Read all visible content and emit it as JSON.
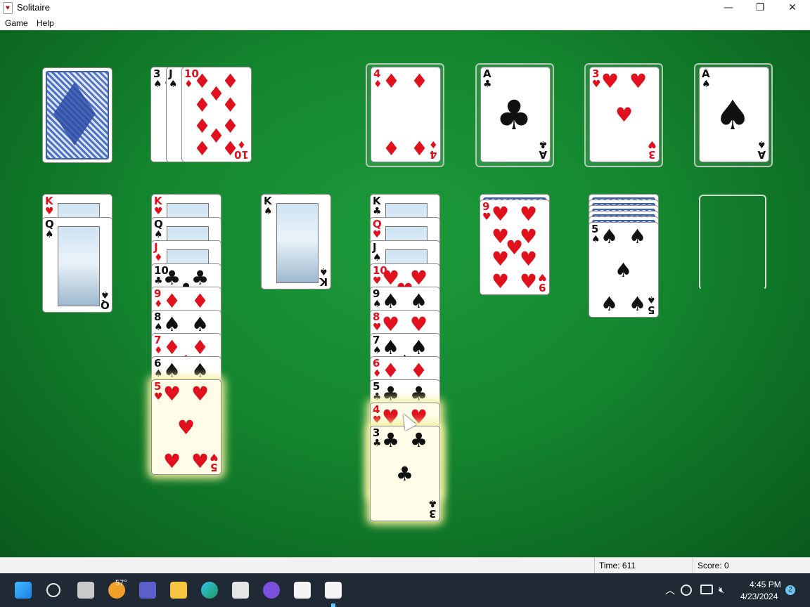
{
  "window": {
    "title": "Solitaire",
    "controls": {
      "minimize": "—",
      "maximize": "❐",
      "close": "✕"
    }
  },
  "menu": {
    "items": [
      "Game",
      "Help"
    ]
  },
  "stock": {
    "face_down": true
  },
  "waste": {
    "cards": [
      {
        "rank": "3",
        "suit": "♠",
        "color": "black"
      },
      {
        "rank": "J",
        "suit": "♠",
        "color": "black"
      },
      {
        "rank": "10",
        "suit": "♦",
        "color": "red"
      }
    ]
  },
  "foundations": [
    {
      "rank": "4",
      "suit": "♦",
      "color": "red"
    },
    {
      "rank": "A",
      "suit": "♣",
      "color": "black"
    },
    {
      "rank": "3",
      "suit": "♥",
      "color": "red"
    },
    {
      "rank": "A",
      "suit": "♠",
      "color": "black"
    }
  ],
  "tableau": [
    {
      "hidden": 0,
      "cards": [
        {
          "rank": "K",
          "suit": "♥",
          "color": "red"
        },
        {
          "rank": "Q",
          "suit": "♠",
          "color": "black"
        }
      ]
    },
    {
      "hidden": 0,
      "cards": [
        {
          "rank": "K",
          "suit": "♥",
          "color": "red"
        },
        {
          "rank": "Q",
          "suit": "♠",
          "color": "black"
        },
        {
          "rank": "J",
          "suit": "♦",
          "color": "red"
        },
        {
          "rank": "10",
          "suit": "♣",
          "color": "black"
        },
        {
          "rank": "9",
          "suit": "♦",
          "color": "red"
        },
        {
          "rank": "8",
          "suit": "♠",
          "color": "black"
        },
        {
          "rank": "7",
          "suit": "♦",
          "color": "red"
        },
        {
          "rank": "6",
          "suit": "♠",
          "color": "black"
        },
        {
          "rank": "5",
          "suit": "♥",
          "color": "red",
          "highlight": true
        }
      ]
    },
    {
      "hidden": 0,
      "cards": [
        {
          "rank": "K",
          "suit": "♠",
          "color": "black"
        }
      ]
    },
    {
      "hidden": 0,
      "cards": [
        {
          "rank": "K",
          "suit": "♣",
          "color": "black"
        },
        {
          "rank": "Q",
          "suit": "♥",
          "color": "red"
        },
        {
          "rank": "J",
          "suit": "♠",
          "color": "black"
        },
        {
          "rank": "10",
          "suit": "♥",
          "color": "red"
        },
        {
          "rank": "9",
          "suit": "♠",
          "color": "black"
        },
        {
          "rank": "8",
          "suit": "♥",
          "color": "red"
        },
        {
          "rank": "7",
          "suit": "♠",
          "color": "black"
        },
        {
          "rank": "6",
          "suit": "♦",
          "color": "red"
        },
        {
          "rank": "5",
          "suit": "♣",
          "color": "black"
        },
        {
          "rank": "4",
          "suit": "♥",
          "color": "red",
          "highlight": true
        },
        {
          "rank": "3",
          "suit": "♣",
          "color": "black",
          "highlight": true
        }
      ]
    },
    {
      "hidden": 1,
      "cards": [
        {
          "rank": "9",
          "suit": "♥",
          "color": "red"
        }
      ]
    },
    {
      "hidden": 5,
      "cards": [
        {
          "rank": "5",
          "suit": "♠",
          "color": "black"
        }
      ]
    },
    {
      "hidden": 0,
      "cards": []
    }
  ],
  "status": {
    "time_label": "Time:",
    "time": "611",
    "score_label": "Score:",
    "score": "0"
  },
  "taskbar": {
    "weather": "57°",
    "clock_time": "4:45 PM",
    "clock_date": "4/23/2024",
    "notification_count": "2"
  },
  "colors": {
    "felt": "#14862f",
    "red_suit": "#e0101c",
    "black_suit": "#111111",
    "highlight": "#f4f0a0"
  }
}
